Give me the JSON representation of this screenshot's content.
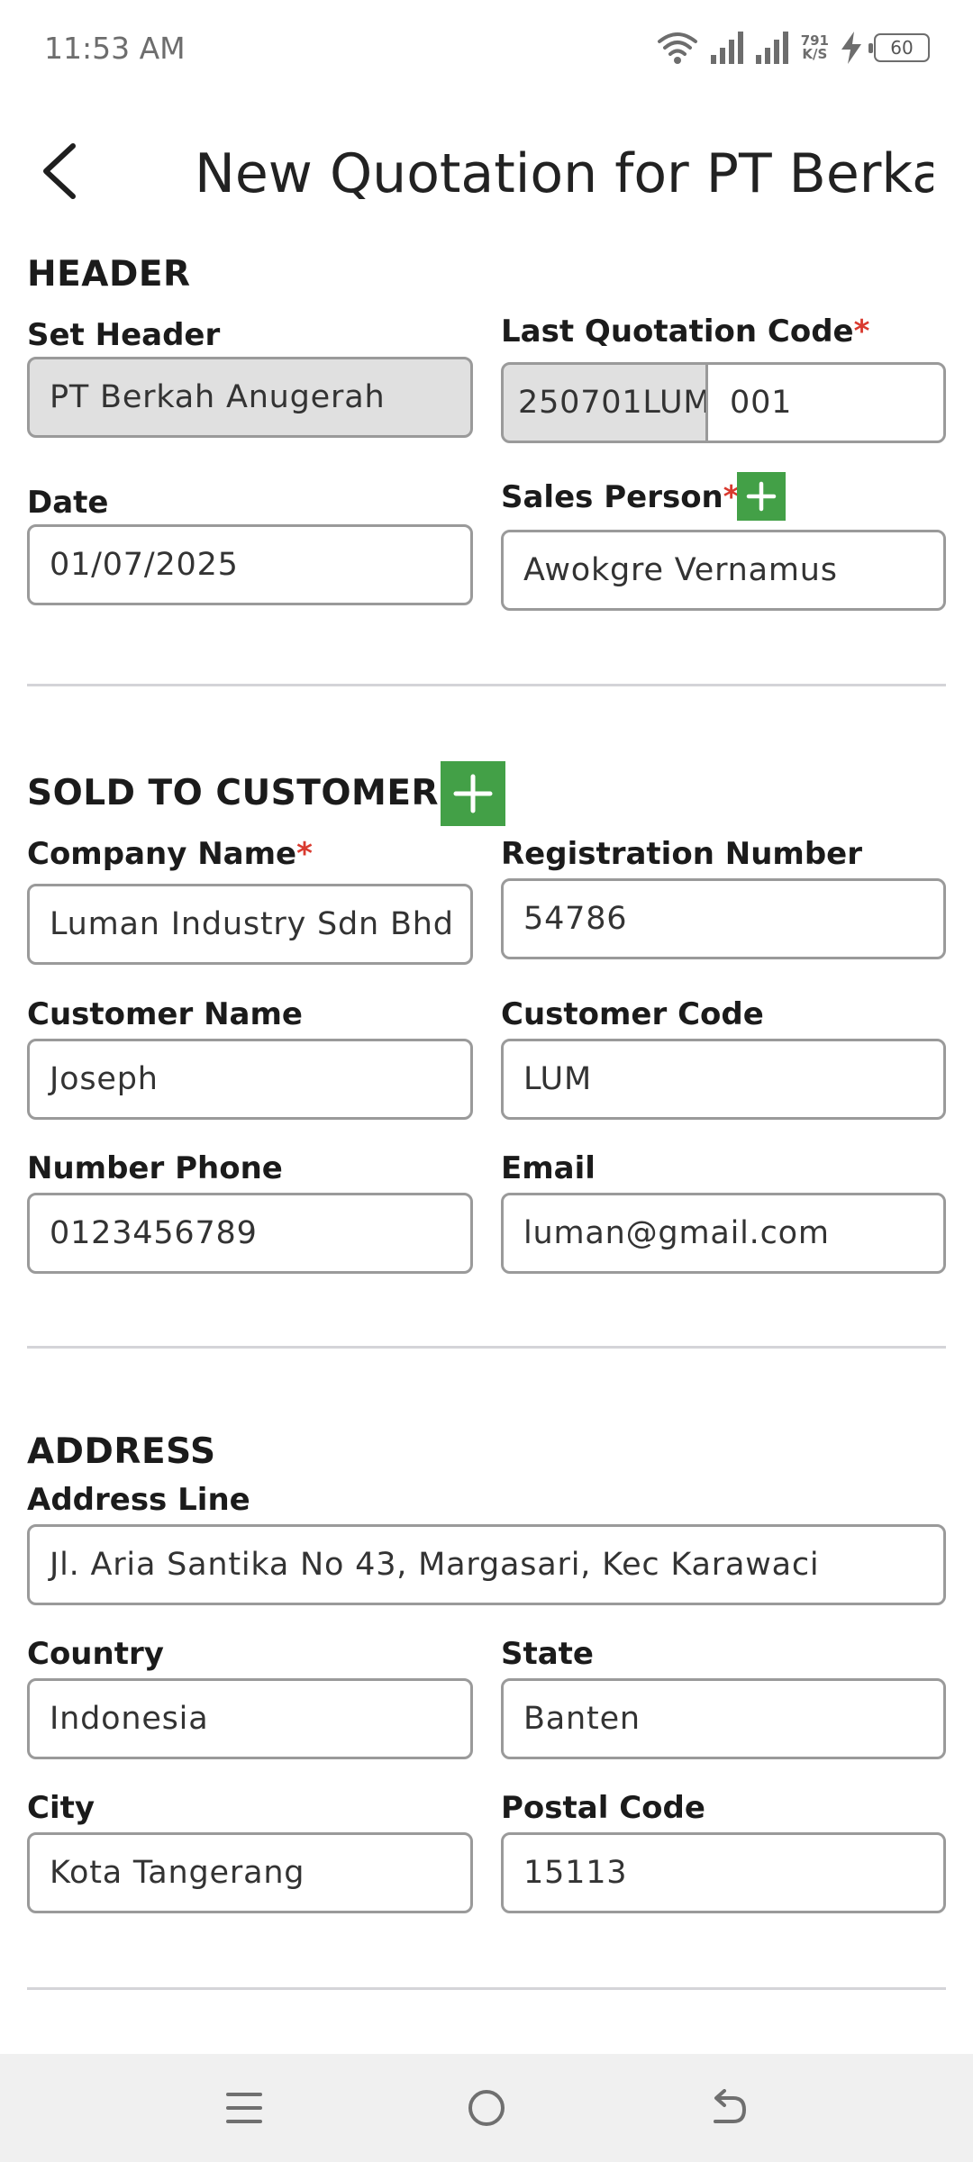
{
  "status_bar": {
    "time": "11:53 AM",
    "net_speed_value": "791",
    "net_speed_unit": "K/S",
    "battery_level": "60"
  },
  "app_bar": {
    "title": "New Quotation for PT Berka..."
  },
  "header_section": {
    "title": "HEADER",
    "set_header_label": "Set Header",
    "set_header_value": "PT Berkah Anugerah",
    "last_quotation_label": "Last Quotation Code",
    "quotation_prefix": "250701LUM",
    "quotation_number": "001",
    "date_label": "Date",
    "date_value": "01/07/2025",
    "sales_person_label": "Sales Person",
    "sales_person_value": "Awokgre Vernamus"
  },
  "customer_section": {
    "title": "SOLD TO CUSTOMER",
    "company_name_label": "Company Name",
    "company_name_value": "Luman Industry Sdn Bhd",
    "registration_label": "Registration Number",
    "registration_value": "54786",
    "customer_name_label": "Customer Name",
    "customer_name_value": "Joseph",
    "customer_code_label": "Customer Code",
    "customer_code_value": "LUM",
    "phone_label": "Number Phone",
    "phone_value": "0123456789",
    "email_label": "Email",
    "email_value": "luman@gmail.com"
  },
  "address_section": {
    "title": "ADDRESS",
    "address_line_label": "Address Line",
    "address_line_value": "Jl. Aria Santika No 43, Margasari, Kec Karawaci",
    "country_label": "Country",
    "country_value": "Indonesia",
    "state_label": "State",
    "state_value": "Banten",
    "city_label": "City",
    "city_value": "Kota Tangerang",
    "postal_label": "Postal Code",
    "postal_value": "15113"
  },
  "required_marker": "*",
  "colors": {
    "accent_green": "#43a047",
    "required_red": "#d93a2f",
    "readonly_bg": "#e0e0e0"
  },
  "icons": [
    "wifi-icon",
    "signal-icon",
    "charging-icon",
    "battery-icon",
    "back-arrow-icon",
    "plus-icon",
    "menu-icon",
    "home-icon",
    "back-icon"
  ]
}
